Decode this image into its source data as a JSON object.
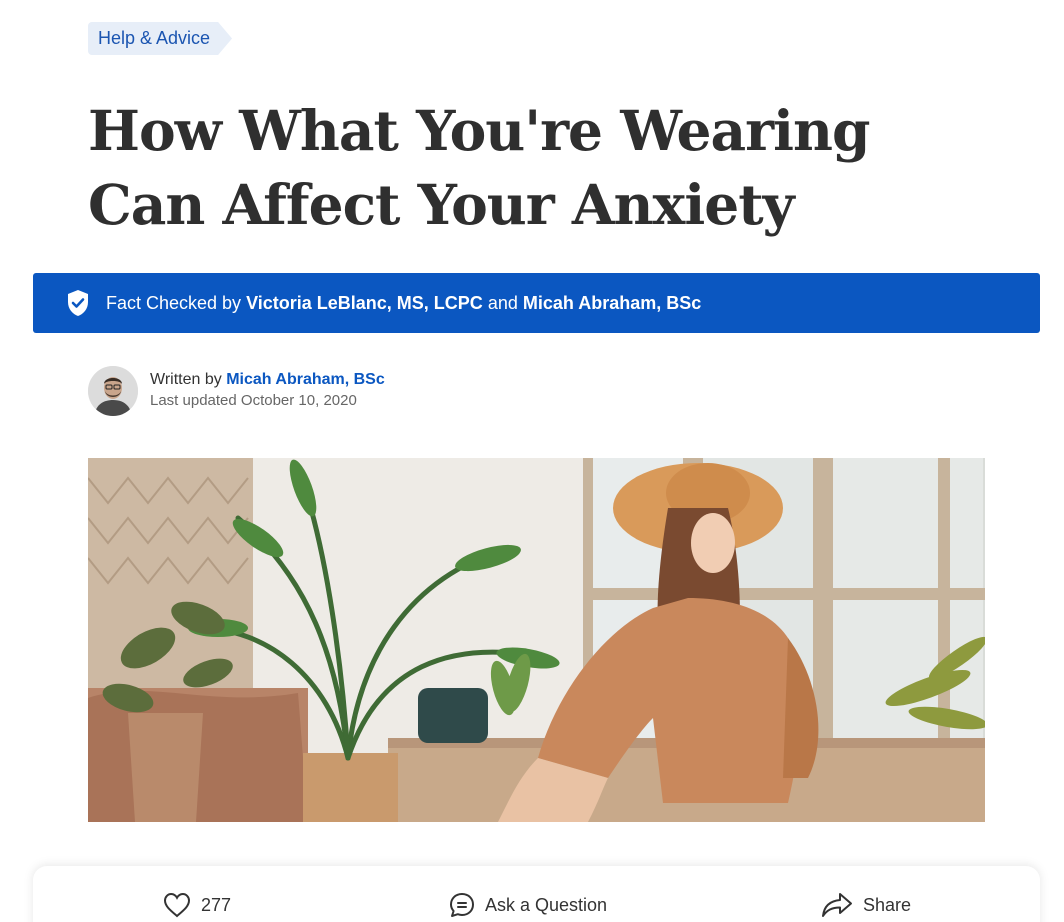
{
  "category": {
    "label": "Help & Advice"
  },
  "article": {
    "title": "How What You're Wearing Can Affect Your Anxiety"
  },
  "fact_check": {
    "prefix": "Fact Checked by",
    "reviewer_1": "Victoria LeBlanc, MS, LCPC",
    "conjunction": "and",
    "reviewer_2": "Micah Abraham, BSc",
    "icon": "shield-check-icon"
  },
  "byline": {
    "written_by": "Written by",
    "author": "Micah Abraham, BSc",
    "last_updated": "Last updated October 10, 2020"
  },
  "actions": {
    "likes_count": "277",
    "ask_label": "Ask a Question",
    "share_label": "Share"
  },
  "colors": {
    "brand_blue": "#0b57c1",
    "tag_bg": "#e7eef8",
    "title": "#2f2f2f"
  }
}
